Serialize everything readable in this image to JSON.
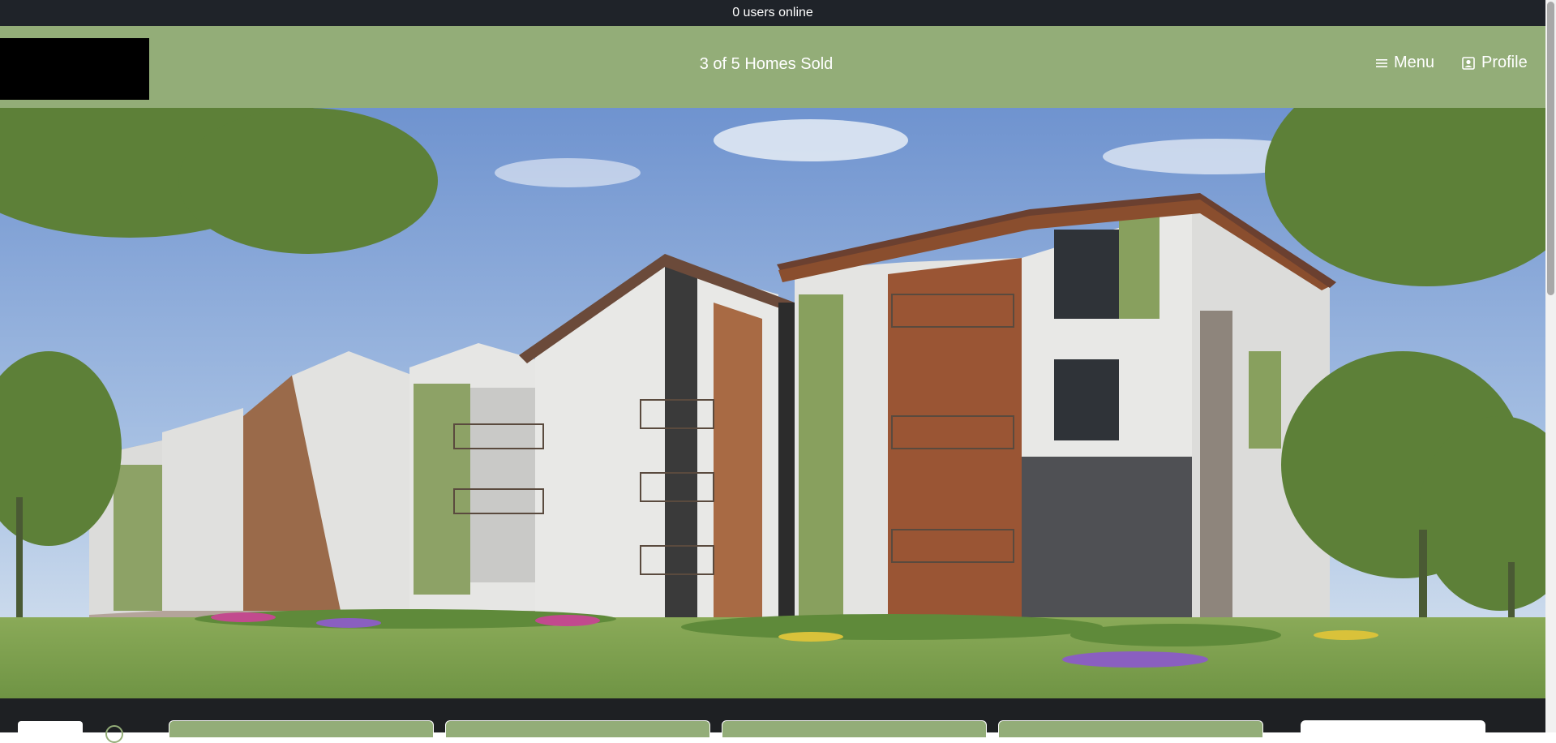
{
  "topbar": {
    "online_text": "0 users online"
  },
  "header": {
    "sold_text": "3 of 5 Homes Sold",
    "menu_label": "Menu",
    "profile_label": "Profile",
    "menu_icon": "hamburger-icon",
    "profile_icon": "person-badge-icon"
  },
  "hero": {
    "image_subject": "apartment-building-rendering"
  },
  "colors": {
    "topbar_bg": "#1f2329",
    "header_bg": "#93ad78",
    "bottom_bg": "#1e2023",
    "card_bg": "#93ad78"
  }
}
